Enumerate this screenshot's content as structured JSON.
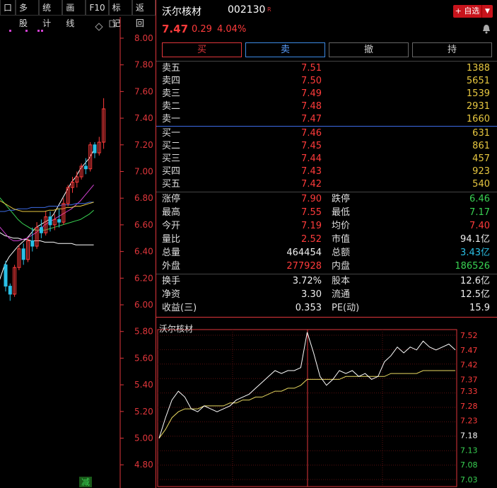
{
  "toolbar": {
    "items": [
      "口",
      "多股",
      "统计",
      "画线",
      "F10",
      "标记",
      "返回"
    ]
  },
  "kchart": {
    "y_ticks": [
      "8.00",
      "7.80",
      "7.60",
      "7.40",
      "7.20",
      "7.00",
      "6.80",
      "6.60",
      "6.40",
      "6.20",
      "6.00",
      "5.80",
      "5.60",
      "5.40",
      "5.20",
      "5.00",
      "4.80"
    ],
    "bottom_badge": "减",
    "colors": {
      "up": "#ff3b3b",
      "down": "#2ac0e6",
      "ma1": "#ffffff",
      "ma2": "#e8c840",
      "ma3": "#d040d0",
      "ma4": "#39d353",
      "ma5": "#3d6be5"
    },
    "candles": [
      {
        "o": 6.3,
        "h": 6.33,
        "l": 6.1,
        "c": 6.14
      },
      {
        "o": 6.14,
        "h": 6.16,
        "l": 6.03,
        "c": 6.08
      },
      {
        "o": 6.08,
        "h": 6.3,
        "l": 6.06,
        "c": 6.28
      },
      {
        "o": 6.28,
        "h": 6.45,
        "l": 6.26,
        "c": 6.42
      },
      {
        "o": 6.42,
        "h": 6.46,
        "l": 6.3,
        "c": 6.34
      },
      {
        "o": 6.34,
        "h": 6.5,
        "l": 6.32,
        "c": 6.48
      },
      {
        "o": 6.48,
        "h": 6.58,
        "l": 6.4,
        "c": 6.44
      },
      {
        "o": 6.44,
        "h": 6.62,
        "l": 6.42,
        "c": 6.58
      },
      {
        "o": 6.58,
        "h": 6.64,
        "l": 6.5,
        "c": 6.54
      },
      {
        "o": 6.54,
        "h": 6.7,
        "l": 6.52,
        "c": 6.66
      },
      {
        "o": 6.66,
        "h": 6.7,
        "l": 6.55,
        "c": 6.6
      },
      {
        "o": 6.6,
        "h": 6.68,
        "l": 6.56,
        "c": 6.64
      },
      {
        "o": 6.64,
        "h": 6.72,
        "l": 6.58,
        "c": 6.62
      },
      {
        "o": 6.62,
        "h": 6.8,
        "l": 6.6,
        "c": 6.76
      },
      {
        "o": 6.76,
        "h": 6.9,
        "l": 6.74,
        "c": 6.88
      },
      {
        "o": 6.88,
        "h": 6.96,
        "l": 6.84,
        "c": 6.92
      },
      {
        "o": 6.92,
        "h": 7.0,
        "l": 6.88,
        "c": 6.96
      },
      {
        "o": 6.96,
        "h": 7.06,
        "l": 6.94,
        "c": 7.04
      },
      {
        "o": 7.04,
        "h": 7.1,
        "l": 6.98,
        "c": 7.02
      },
      {
        "o": 7.02,
        "h": 7.22,
        "l": 7.0,
        "c": 7.2
      },
      {
        "o": 7.2,
        "h": 7.22,
        "l": 7.1,
        "c": 7.14
      },
      {
        "o": 7.14,
        "h": 7.26,
        "l": 7.12,
        "c": 7.22
      },
      {
        "o": 7.22,
        "h": 7.55,
        "l": 7.17,
        "c": 7.47
      }
    ],
    "ma_lines": [
      {
        "color": "#ffffff",
        "values": [
          6.1,
          6.2,
          6.3,
          6.36,
          6.4,
          6.44,
          6.47,
          6.5,
          6.54,
          6.58,
          6.6,
          6.62,
          6.64,
          6.68,
          6.74,
          6.8,
          6.86,
          6.92,
          6.96,
          7.02,
          7.06,
          7.1,
          7.16
        ]
      },
      {
        "color": "#ffffff",
        "values": [
          6.56,
          6.54,
          6.52,
          6.51,
          6.5,
          6.5,
          6.49,
          6.49,
          6.48,
          6.48,
          6.48,
          6.47,
          6.47,
          6.47,
          6.46,
          6.46,
          6.46,
          6.46,
          6.45,
          6.45,
          6.45,
          6.45,
          6.45
        ]
      },
      {
        "color": "#d040d0",
        "values": [
          6.62,
          6.58,
          6.54,
          6.5,
          6.48,
          6.48,
          6.49,
          6.5,
          6.52,
          6.54,
          6.57,
          6.6,
          6.62,
          6.64,
          6.66,
          6.68,
          6.7,
          6.72,
          6.75,
          6.78,
          6.82,
          6.86,
          6.9
        ]
      },
      {
        "color": "#39d353",
        "values": [
          6.84,
          6.8,
          6.76,
          6.72,
          6.68,
          6.64,
          6.61,
          6.59,
          6.57,
          6.56,
          6.56,
          6.56,
          6.57,
          6.58,
          6.59,
          6.6,
          6.61,
          6.62,
          6.63,
          6.64,
          6.66,
          6.68,
          6.71
        ]
      },
      {
        "color": "#3d6be5",
        "values": [
          6.7,
          6.7,
          6.7,
          6.71,
          6.71,
          6.72,
          6.72,
          6.72,
          6.73,
          6.73,
          6.73,
          6.73,
          6.74,
          6.74,
          6.74,
          6.75,
          6.75,
          6.75,
          6.76,
          6.76,
          6.76,
          6.77,
          6.77
        ]
      },
      {
        "color": "#e8c840",
        "values": [
          6.8,
          6.78,
          6.76,
          6.74,
          6.72,
          6.71,
          6.7,
          6.7,
          6.7,
          6.7,
          6.7,
          6.7,
          6.71,
          6.71,
          6.72,
          6.72,
          6.73,
          6.73,
          6.74,
          6.74,
          6.75,
          6.76,
          6.77
        ]
      }
    ]
  },
  "stock": {
    "name": "沃尔核材",
    "code": "002130",
    "tag": "R",
    "price": "7.47",
    "change": "0.29",
    "change_pct": "4.04%",
    "watch_label": "+ 自选",
    "watch_dropdown": "▼"
  },
  "trade_buttons": {
    "buy": "买",
    "sell": "卖",
    "cancel": "撤",
    "hold": "持"
  },
  "asks": [
    {
      "label": "卖五",
      "price": "7.51",
      "vol": "1388"
    },
    {
      "label": "卖四",
      "price": "7.50",
      "vol": "5651"
    },
    {
      "label": "卖三",
      "price": "7.49",
      "vol": "1539"
    },
    {
      "label": "卖二",
      "price": "7.48",
      "vol": "2931"
    },
    {
      "label": "卖一",
      "price": "7.47",
      "vol": "1660"
    }
  ],
  "bids": [
    {
      "label": "买一",
      "price": "7.46",
      "vol": "631"
    },
    {
      "label": "买二",
      "price": "7.45",
      "vol": "861"
    },
    {
      "label": "买三",
      "price": "7.44",
      "vol": "457"
    },
    {
      "label": "买四",
      "price": "7.43",
      "vol": "923"
    },
    {
      "label": "买五",
      "price": "7.42",
      "vol": "540"
    }
  ],
  "stats1": [
    {
      "l1": "涨停",
      "v1": "7.90",
      "c1": "red",
      "l2": "跌停",
      "v2": "6.46",
      "c2": "green"
    },
    {
      "l1": "最高",
      "v1": "7.55",
      "c1": "red",
      "l2": "最低",
      "v2": "7.17",
      "c2": "green"
    },
    {
      "l1": "今开",
      "v1": "7.19",
      "c1": "red",
      "l2": "均价",
      "v2": "7.40",
      "c2": "red"
    },
    {
      "l1": "量比",
      "v1": "2.52",
      "c1": "red",
      "l2": "市值",
      "v2": "94.1亿",
      "c2": "white"
    },
    {
      "l1": "总量",
      "v1": "464454",
      "c1": "white",
      "l2": "总额",
      "v2": "3.43亿",
      "c2": "cyan"
    },
    {
      "l1": "外盘",
      "v1": "277928",
      "c1": "red",
      "l2": "内盘",
      "v2": "186526",
      "c2": "green"
    }
  ],
  "stats2": [
    {
      "l1": "换手",
      "v1": "3.72%",
      "c1": "white",
      "l2": "股本",
      "v2": "12.6亿",
      "c2": "white"
    },
    {
      "l1": "净资",
      "v1": "3.30",
      "c1": "white",
      "l2": "流通",
      "v2": "12.5亿",
      "c2": "white"
    },
    {
      "l1": "收益(三)",
      "v1": "0.353",
      "c1": "white",
      "l2": "PE(动)",
      "v2": "15.9",
      "c2": "white"
    }
  ],
  "intraday": {
    "title": "沃尔核材",
    "y_ticks": [
      {
        "label": "7.52",
        "color": "#ff3b3b"
      },
      {
        "label": "7.47",
        "color": "#ff3b3b"
      },
      {
        "label": "7.42",
        "color": "#ff3b3b"
      },
      {
        "label": "7.37",
        "color": "#ff3b3b"
      },
      {
        "label": "7.33",
        "color": "#ff3b3b"
      },
      {
        "label": "7.28",
        "color": "#ff3b3b"
      },
      {
        "label": "7.23",
        "color": "#ff3b3b"
      },
      {
        "label": "7.18",
        "color": "#ffffff"
      },
      {
        "label": "7.13",
        "color": "#39d353"
      },
      {
        "label": "7.08",
        "color": "#39d353"
      },
      {
        "label": "7.03",
        "color": "#39d353"
      }
    ],
    "price_line": [
      7.17,
      7.24,
      7.3,
      7.33,
      7.31,
      7.27,
      7.26,
      7.28,
      7.27,
      7.26,
      7.27,
      7.28,
      7.3,
      7.31,
      7.32,
      7.34,
      7.36,
      7.38,
      7.4,
      7.39,
      7.4,
      7.4,
      7.41,
      7.53,
      7.46,
      7.38,
      7.35,
      7.37,
      7.4,
      7.39,
      7.4,
      7.38,
      7.39,
      7.37,
      7.38,
      7.43,
      7.45,
      7.48,
      7.46,
      7.48,
      7.47,
      7.5,
      7.48,
      7.47,
      7.48,
      7.49,
      7.47
    ],
    "avg_line": [
      7.17,
      7.2,
      7.24,
      7.26,
      7.27,
      7.27,
      7.27,
      7.28,
      7.28,
      7.28,
      7.28,
      7.29,
      7.29,
      7.3,
      7.3,
      7.31,
      7.31,
      7.32,
      7.33,
      7.33,
      7.34,
      7.34,
      7.35,
      7.37,
      7.37,
      7.37,
      7.37,
      7.37,
      7.37,
      7.38,
      7.38,
      7.38,
      7.38,
      7.38,
      7.38,
      7.38,
      7.39,
      7.39,
      7.39,
      7.39,
      7.39,
      7.4,
      7.4,
      7.4,
      7.4,
      7.4,
      7.4
    ]
  }
}
